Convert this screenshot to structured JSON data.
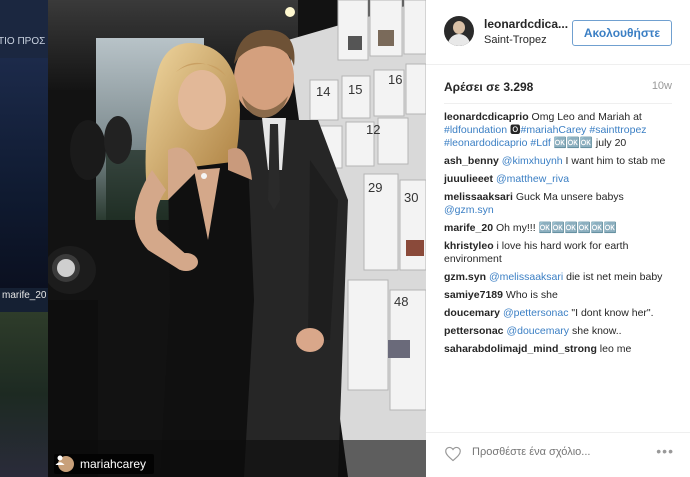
{
  "background": {
    "left_text": "ΤΙΟ ΠΡΟΣ",
    "caption": "marife_20"
  },
  "photo": {
    "tag": {
      "icon": "person-tag-icon",
      "username": "mariahcarey"
    },
    "board_numbers": [
      "15",
      "16",
      "14",
      "12",
      "29",
      "30",
      "48"
    ]
  },
  "post": {
    "username": "leonardcdica...",
    "location": "Saint-Tropez",
    "follow_label": "Ακολουθήστε",
    "likes": "Αρέσει σε 3.298",
    "time": "10w",
    "comments": [
      {
        "user": "leonardcdicaprio",
        "parts": [
          {
            "t": "Omg Leo and Mariah at "
          },
          {
            "m": "#ldfoundation"
          },
          {
            "t": " 🅾"
          },
          {
            "m": "#mariahCarey"
          },
          {
            "t": " "
          },
          {
            "m": "#sainttropez"
          },
          {
            "t": " "
          },
          {
            "m": "#leonardodicaprio"
          },
          {
            "t": " "
          },
          {
            "m": "#Ldf"
          },
          {
            "t": " 🆗🆗🆗 july 20"
          }
        ]
      },
      {
        "user": "ash_benny",
        "parts": [
          {
            "m": "@kimxhuynh"
          },
          {
            "t": " I want him to stab me"
          }
        ]
      },
      {
        "user": "juuulieeet",
        "parts": [
          {
            "m": "@matthew_riva"
          }
        ]
      },
      {
        "user": "melissaaksari",
        "parts": [
          {
            "t": "Guck Ma unsere babys "
          },
          {
            "m": "@gzm.syn"
          }
        ]
      },
      {
        "user": "marife_20",
        "parts": [
          {
            "t": "Oh my!!! 🆗🆗🆗🆗🆗🆗"
          }
        ]
      },
      {
        "user": "khristyleo",
        "parts": [
          {
            "t": "i love his hard work for earth environment"
          }
        ]
      },
      {
        "user": "gzm.syn",
        "parts": [
          {
            "m": "@melissaaksari"
          },
          {
            "t": " die ist net mein baby"
          }
        ]
      },
      {
        "user": "samiye7189",
        "parts": [
          {
            "t": "Who is she"
          }
        ]
      },
      {
        "user": "doucemary",
        "parts": [
          {
            "m": "@pettersonac"
          },
          {
            "t": " \"I dont know her\"."
          }
        ]
      },
      {
        "user": "pettersonac",
        "parts": [
          {
            "m": "@doucemary"
          },
          {
            "t": " she know.."
          }
        ]
      },
      {
        "user": "saharabdolimajd_mind_strong",
        "parts": [
          {
            "t": "leo me"
          }
        ]
      }
    ],
    "add_comment_placeholder": "Προσθέστε ένα σχόλιο...",
    "more_label": "•••"
  },
  "colors": {
    "link": "#3b7fc4",
    "follow_border": "#70a0d0",
    "text": "#262626",
    "muted": "#999999"
  }
}
